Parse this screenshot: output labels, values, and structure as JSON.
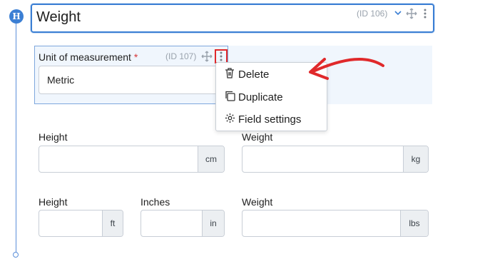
{
  "heading_badge": "H",
  "title_field": {
    "value": "Weight",
    "id_label": "(ID 106)"
  },
  "unit_field": {
    "label": "Unit of measurement",
    "required_mark": "*",
    "id_label": "(ID 107)",
    "selected": "Metric"
  },
  "context_menu": {
    "items": [
      {
        "label": "Delete",
        "icon": "trash-icon"
      },
      {
        "label": "Duplicate",
        "icon": "duplicate-icon"
      },
      {
        "label": "Field settings",
        "icon": "gear-icon"
      }
    ]
  },
  "metric_row": [
    {
      "label": "Height",
      "unit": "cm"
    },
    {
      "label": "Weight",
      "unit": "kg"
    }
  ],
  "imperial_row": [
    {
      "label": "Height",
      "unit": "ft"
    },
    {
      "label": "Inches",
      "unit": "in"
    },
    {
      "label": "Weight",
      "unit": "lbs"
    }
  ],
  "colors": {
    "accent": "#3b7fd4",
    "annotation": "#e0292b",
    "panel": "#f0f6fd"
  }
}
